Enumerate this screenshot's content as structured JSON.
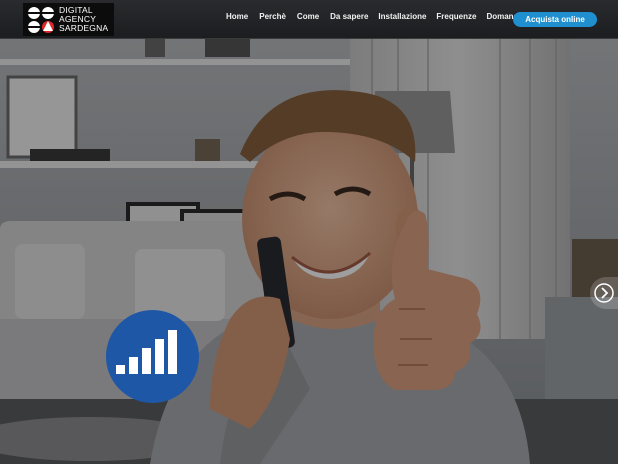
{
  "brand": {
    "line1": "DIGITAL",
    "line2": "AGENCY",
    "line3": "SARDEGNA"
  },
  "nav": {
    "items": [
      {
        "label": "Home"
      },
      {
        "label": "Perchè"
      },
      {
        "label": "Come"
      },
      {
        "label": "Da sapere"
      },
      {
        "label": "Installazione"
      },
      {
        "label": "Frequenze"
      },
      {
        "label": "Domande"
      }
    ],
    "cta_label": "Acquista online"
  },
  "colors": {
    "accent": "#1f8fd0",
    "signal_badge": "#1f57a7",
    "overlay": "#000000"
  },
  "icons": {
    "signal": "signal-bars-icon",
    "next": "chevron-right-icon"
  }
}
